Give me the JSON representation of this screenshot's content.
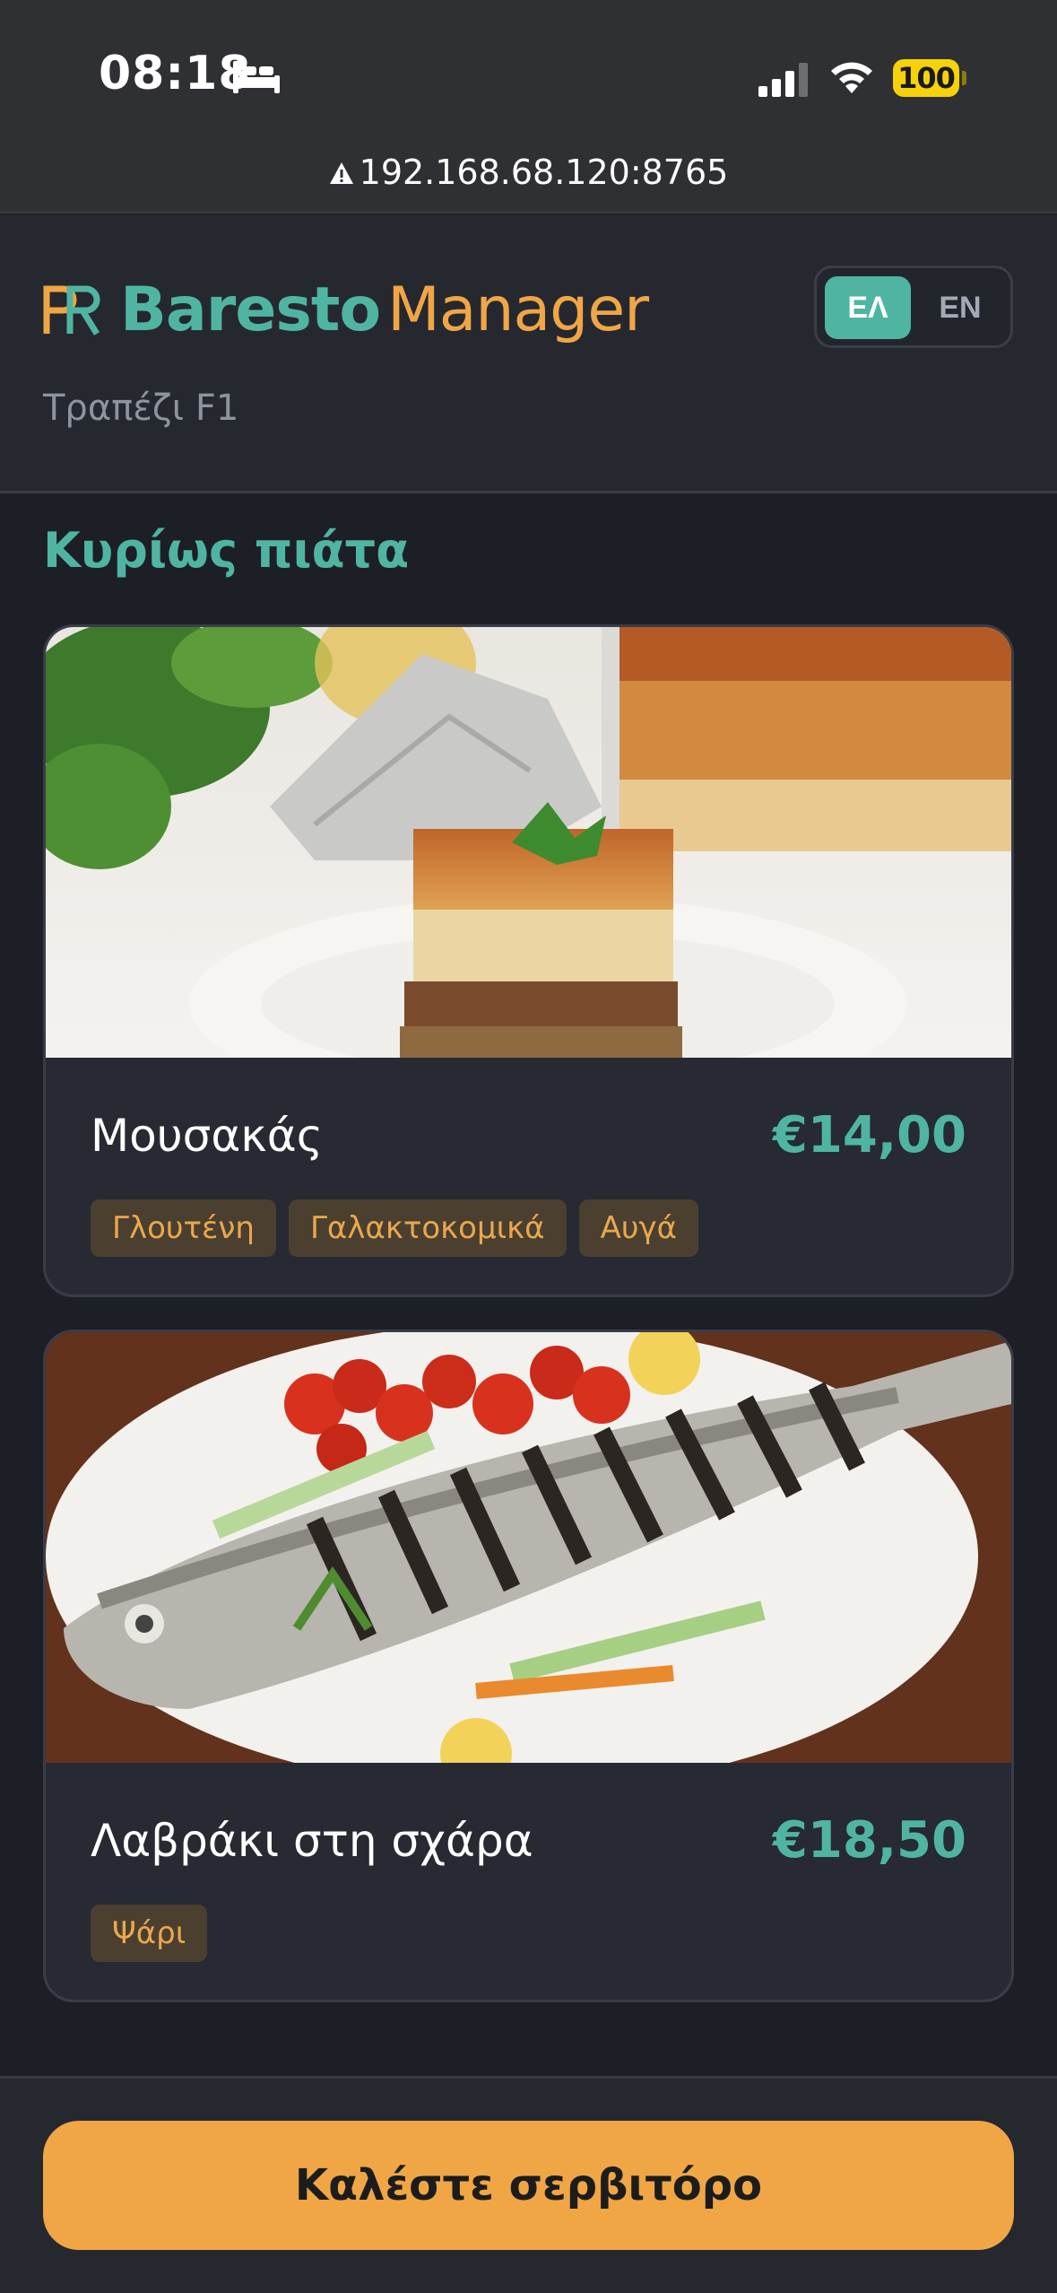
{
  "status_bar": {
    "time": "08:18",
    "battery": "100"
  },
  "browser": {
    "url": "192.168.68.120:8765"
  },
  "header": {
    "brand_primary": "Baresto",
    "brand_secondary": "Manager",
    "table_label": "Τραπέζι F1",
    "languages": [
      "ΕΛ",
      "EN"
    ],
    "active_language": "ΕΛ"
  },
  "menu": {
    "section_title": "Κυρίως πιάτα",
    "items": [
      {
        "name": "Μουσακάς",
        "price": "€14,00",
        "tags": [
          "Γλουτένη",
          "Γαλακτοκομικά",
          "Αυγά"
        ]
      },
      {
        "name": "Λαβράκι στη σχάρα",
        "price": "€18,50",
        "tags": [
          "Ψάρι"
        ]
      }
    ]
  },
  "footer": {
    "call_waiter_label": "Καλέστε σερβιτόρο"
  },
  "colors": {
    "accent_teal": "#4fb5a2",
    "accent_orange": "#f0a645",
    "tag_bg": "#4b3f30",
    "background": "#1d1f26"
  }
}
